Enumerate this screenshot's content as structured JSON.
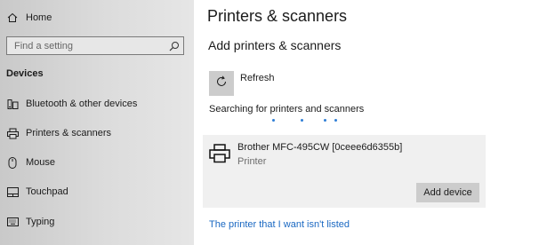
{
  "sidebar": {
    "home_label": "Home",
    "search_placeholder": "Find a setting",
    "section_header": "Devices",
    "items": [
      {
        "label": "Bluetooth & other devices",
        "icon": "bluetooth-devices-icon"
      },
      {
        "label": "Printers & scanners",
        "icon": "printer-icon"
      },
      {
        "label": "Mouse",
        "icon": "mouse-icon"
      },
      {
        "label": "Touchpad",
        "icon": "touchpad-icon"
      },
      {
        "label": "Typing",
        "icon": "keyboard-icon"
      }
    ]
  },
  "main": {
    "title": "Printers & scanners",
    "subtitle": "Add printers & scanners",
    "refresh_label": "Refresh",
    "searching_text": "Searching for printers and scanners",
    "device": {
      "name": "Brother MFC-495CW [0ceee6d6355b]",
      "type": "Printer",
      "add_button_label": "Add device"
    },
    "not_listed_link": "The printer that I want isn't listed"
  },
  "colors": {
    "accent": "#2f7fd6",
    "link": "#1a68c2",
    "card_bg": "#f0f0f0",
    "button_bg": "#cccccc"
  }
}
